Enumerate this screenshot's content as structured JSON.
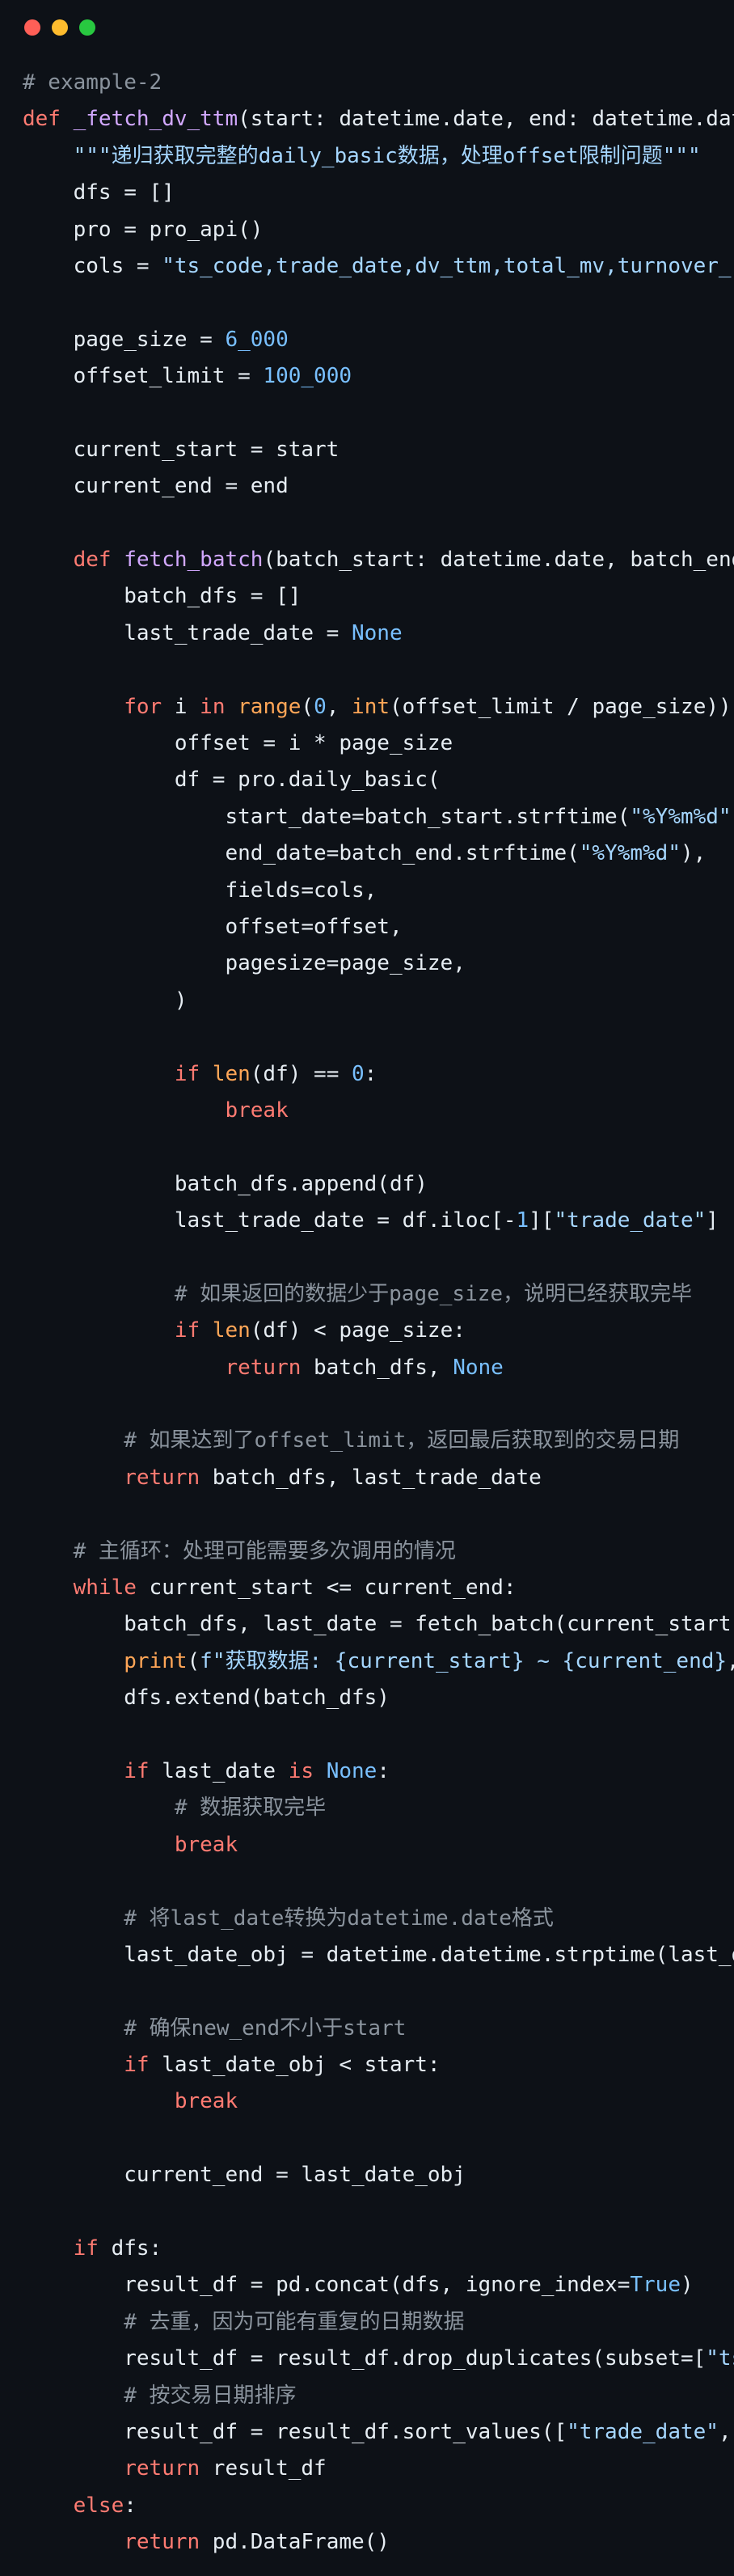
{
  "window": {
    "buttons": [
      {
        "name": "close",
        "color": "#ff5f57"
      },
      {
        "name": "minimize",
        "color": "#febc2e"
      },
      {
        "name": "zoom",
        "color": "#28c840"
      }
    ]
  },
  "colors": {
    "background": "#0d1117",
    "keyword": "#ff7b72",
    "function": "#d2a8ff",
    "string": "#a5d6ff",
    "number": "#79c0ff",
    "constant": "#79c0ff",
    "builtin": "#ffa657",
    "comment": "#8b949e",
    "plain": "#e6edf3"
  },
  "code_lines": [
    [
      [
        "comment",
        "# example-2"
      ]
    ],
    [
      [
        "kw",
        "def "
      ],
      [
        "fn",
        "_fetch_dv_ttm"
      ],
      [
        "plain",
        "(start: datetime.date, end: datetime.dat"
      ]
    ],
    [
      [
        "plain",
        "    "
      ],
      [
        "str",
        "\"\"\"递归获取完整的daily_basic数据，处理offset限制问题\"\"\""
      ]
    ],
    [
      [
        "plain",
        "    dfs = []"
      ]
    ],
    [
      [
        "plain",
        "    pro = pro_api()"
      ]
    ],
    [
      [
        "plain",
        "    cols = "
      ],
      [
        "str",
        "\"ts_code,trade_date,dv_ttm,total_mv,turnover_"
      ]
    ],
    [],
    [
      [
        "plain",
        "    page_size = "
      ],
      [
        "num",
        "6_000"
      ]
    ],
    [
      [
        "plain",
        "    offset_limit = "
      ],
      [
        "num",
        "100_000"
      ]
    ],
    [],
    [
      [
        "plain",
        "    current_start = start"
      ]
    ],
    [
      [
        "plain",
        "    current_end = end"
      ]
    ],
    [],
    [
      [
        "plain",
        "    "
      ],
      [
        "kw",
        "def "
      ],
      [
        "fn",
        "fetch_batch"
      ],
      [
        "plain",
        "(batch_start: datetime.date, batch_end"
      ]
    ],
    [
      [
        "plain",
        "        batch_dfs = []"
      ]
    ],
    [
      [
        "plain",
        "        last_trade_date = "
      ],
      [
        "const",
        "None"
      ]
    ],
    [],
    [
      [
        "plain",
        "        "
      ],
      [
        "kw",
        "for"
      ],
      [
        "plain",
        " i "
      ],
      [
        "kw",
        "in"
      ],
      [
        "plain",
        " "
      ],
      [
        "builtin",
        "range"
      ],
      [
        "plain",
        "("
      ],
      [
        "num",
        "0"
      ],
      [
        "plain",
        ", "
      ],
      [
        "builtin",
        "int"
      ],
      [
        "plain",
        "(offset_limit / page_size))"
      ]
    ],
    [
      [
        "plain",
        "            offset = i * page_size"
      ]
    ],
    [
      [
        "plain",
        "            df = pro.daily_basic("
      ]
    ],
    [
      [
        "plain",
        "                start_date=batch_start.strftime("
      ],
      [
        "str",
        "\"%Y%m%d\""
      ]
    ],
    [
      [
        "plain",
        "                end_date=batch_end.strftime("
      ],
      [
        "str",
        "\"%Y%m%d\""
      ],
      [
        "plain",
        "),"
      ]
    ],
    [
      [
        "plain",
        "                fields=cols,"
      ]
    ],
    [
      [
        "plain",
        "                offset=offset,"
      ]
    ],
    [
      [
        "plain",
        "                pagesize=page_size,"
      ]
    ],
    [
      [
        "plain",
        "            )"
      ]
    ],
    [],
    [
      [
        "plain",
        "            "
      ],
      [
        "kw",
        "if"
      ],
      [
        "plain",
        " "
      ],
      [
        "builtin",
        "len"
      ],
      [
        "plain",
        "(df) == "
      ],
      [
        "num",
        "0"
      ],
      [
        "plain",
        ":"
      ]
    ],
    [
      [
        "plain",
        "                "
      ],
      [
        "kw",
        "break"
      ]
    ],
    [],
    [
      [
        "plain",
        "            batch_dfs.append(df)"
      ]
    ],
    [
      [
        "plain",
        "            last_trade_date = df.iloc[-"
      ],
      [
        "num",
        "1"
      ],
      [
        "plain",
        "]["
      ],
      [
        "str",
        "\"trade_date\""
      ],
      [
        "plain",
        "]"
      ]
    ],
    [],
    [
      [
        "plain",
        "            "
      ],
      [
        "comment",
        "# 如果返回的数据少于page_size，说明已经获取完毕"
      ]
    ],
    [
      [
        "plain",
        "            "
      ],
      [
        "kw",
        "if"
      ],
      [
        "plain",
        " "
      ],
      [
        "builtin",
        "len"
      ],
      [
        "plain",
        "(df) < page_size:"
      ]
    ],
    [
      [
        "plain",
        "                "
      ],
      [
        "kw",
        "return"
      ],
      [
        "plain",
        " batch_dfs, "
      ],
      [
        "const",
        "None"
      ]
    ],
    [],
    [
      [
        "plain",
        "        "
      ],
      [
        "comment",
        "# 如果达到了offset_limit，返回最后获取到的交易日期"
      ]
    ],
    [
      [
        "plain",
        "        "
      ],
      [
        "kw",
        "return"
      ],
      [
        "plain",
        " batch_dfs, last_trade_date"
      ]
    ],
    [],
    [
      [
        "plain",
        "    "
      ],
      [
        "comment",
        "# 主循环：处理可能需要多次调用的情况"
      ]
    ],
    [
      [
        "plain",
        "    "
      ],
      [
        "kw",
        "while"
      ],
      [
        "plain",
        " current_start <= current_end:"
      ]
    ],
    [
      [
        "plain",
        "        batch_dfs, last_date = fetch_batch(current_start"
      ]
    ],
    [
      [
        "plain",
        "        "
      ],
      [
        "builtin",
        "print"
      ],
      [
        "plain",
        "("
      ],
      [
        "str",
        "f\"获取数据: {current_start} ~ {current_end}"
      ],
      [
        "plain",
        ","
      ]
    ],
    [
      [
        "plain",
        "        dfs.extend(batch_dfs)"
      ]
    ],
    [],
    [
      [
        "plain",
        "        "
      ],
      [
        "kw",
        "if"
      ],
      [
        "plain",
        " last_date "
      ],
      [
        "kw",
        "is"
      ],
      [
        "plain",
        " "
      ],
      [
        "const",
        "None"
      ],
      [
        "plain",
        ":"
      ]
    ],
    [
      [
        "plain",
        "            "
      ],
      [
        "comment",
        "# 数据获取完毕"
      ]
    ],
    [
      [
        "plain",
        "            "
      ],
      [
        "kw",
        "break"
      ]
    ],
    [],
    [
      [
        "plain",
        "        "
      ],
      [
        "comment",
        "# 将last_date转换为datetime.date格式"
      ]
    ],
    [
      [
        "plain",
        "        last_date_obj = datetime.datetime.strptime(last_d"
      ]
    ],
    [],
    [
      [
        "plain",
        "        "
      ],
      [
        "comment",
        "# 确保new_end不小于start"
      ]
    ],
    [
      [
        "plain",
        "        "
      ],
      [
        "kw",
        "if"
      ],
      [
        "plain",
        " last_date_obj < start:"
      ]
    ],
    [
      [
        "plain",
        "            "
      ],
      [
        "kw",
        "break"
      ]
    ],
    [],
    [
      [
        "plain",
        "        current_end = last_date_obj"
      ]
    ],
    [],
    [
      [
        "plain",
        "    "
      ],
      [
        "kw",
        "if"
      ],
      [
        "plain",
        " dfs:"
      ]
    ],
    [
      [
        "plain",
        "        result_df = pd.concat(dfs, ignore_index="
      ],
      [
        "const",
        "True"
      ],
      [
        "plain",
        ")"
      ]
    ],
    [
      [
        "plain",
        "        "
      ],
      [
        "comment",
        "# 去重，因为可能有重复的日期数据"
      ]
    ],
    [
      [
        "plain",
        "        result_df = result_df.drop_duplicates(subset=["
      ],
      [
        "str",
        "\"ts"
      ]
    ],
    [
      [
        "plain",
        "        "
      ],
      [
        "comment",
        "# 按交易日期排序"
      ]
    ],
    [
      [
        "plain",
        "        result_df = result_df.sort_values(["
      ],
      [
        "str",
        "\"trade_date\""
      ],
      [
        "plain",
        ","
      ]
    ],
    [
      [
        "plain",
        "        "
      ],
      [
        "kw",
        "return"
      ],
      [
        "plain",
        " result_df"
      ]
    ],
    [
      [
        "plain",
        "    "
      ],
      [
        "kw",
        "else"
      ],
      [
        "plain",
        ":"
      ]
    ],
    [
      [
        "plain",
        "        "
      ],
      [
        "kw",
        "return"
      ],
      [
        "plain",
        " pd.DataFrame()"
      ]
    ]
  ]
}
